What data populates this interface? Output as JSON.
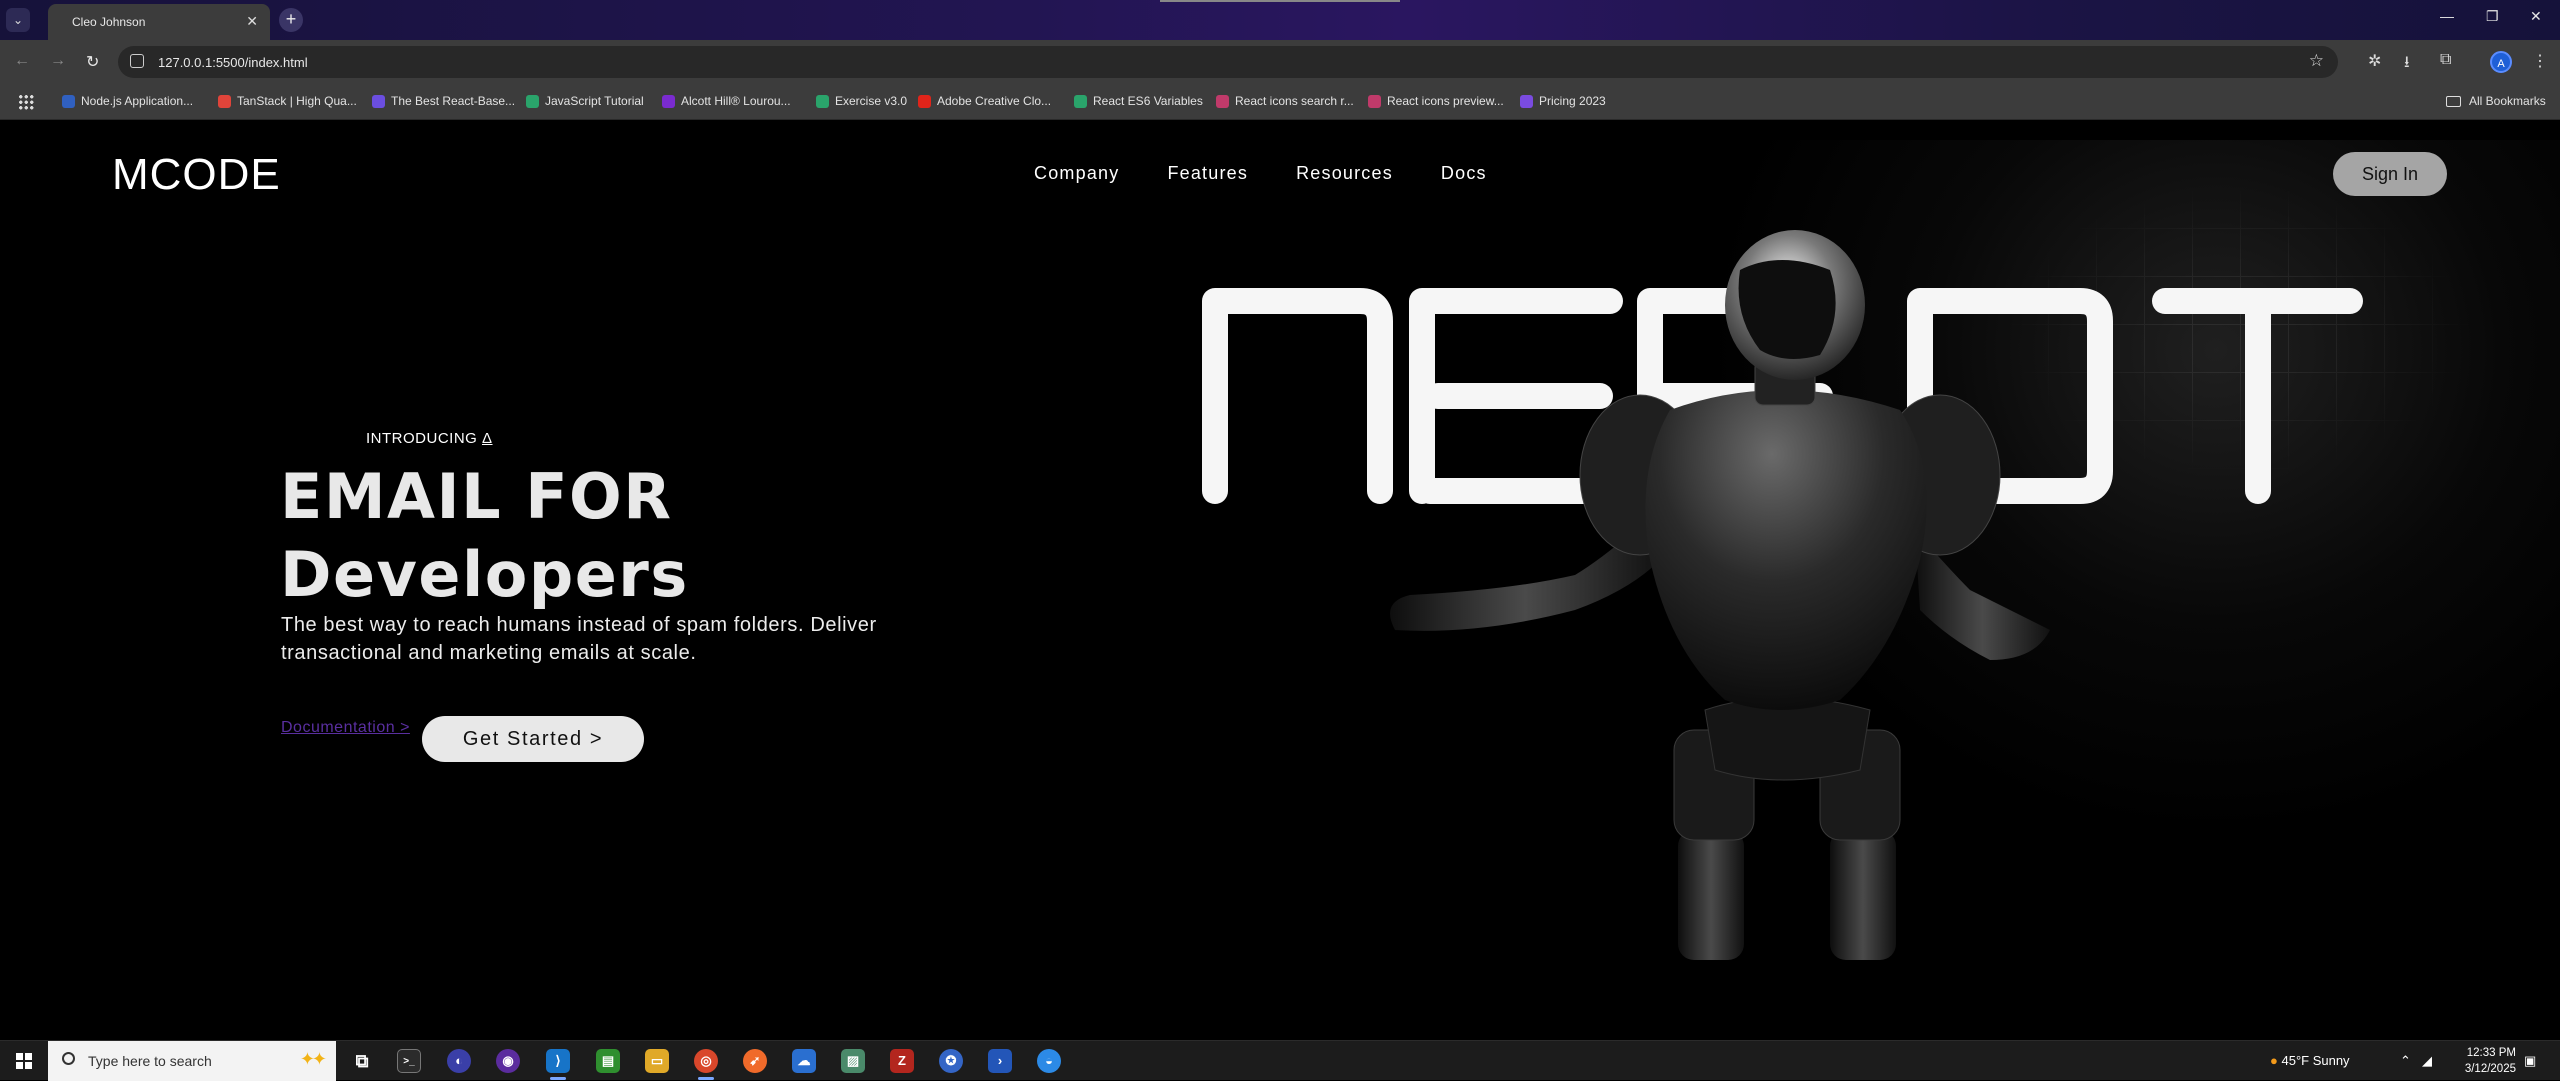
{
  "browser": {
    "tab_title": "Cleo Johnson",
    "url": "127.0.0.1:5500/index.html",
    "profile_initial": "A",
    "bookmarks": [
      {
        "label": "Node.js Application...",
        "color": "#3060c0"
      },
      {
        "label": "TanStack | High Qua...",
        "color": "#e0443a"
      },
      {
        "label": "The Best React-Base...",
        "color": "#6b4ee0"
      },
      {
        "label": "JavaScript Tutorial",
        "color": "#2aa46b"
      },
      {
        "label": "Alcott Hill® Lourou...",
        "color": "#7a2bd0"
      },
      {
        "label": "Exercise v3.0",
        "color": "#2aa46b"
      },
      {
        "label": "Adobe Creative Clo...",
        "color": "#e0241a"
      },
      {
        "label": "React ES6 Variables",
        "color": "#2aa46b"
      },
      {
        "label": "React icons search r...",
        "color": "#c03a6a"
      },
      {
        "label": "React icons preview...",
        "color": "#c03a6a"
      },
      {
        "label": "Pricing 2023",
        "color": "#7a4be0"
      }
    ],
    "all_bookmarks": "All Bookmarks"
  },
  "site": {
    "logo": "MCODE",
    "nav": [
      "Company",
      "Features",
      "Resources",
      "Docs"
    ],
    "signin_label": "Sign In",
    "intro": "INTRODUCING",
    "intro_mark": "Δ",
    "headline_line1": "EMAIL FOR",
    "headline_line2": "Developers",
    "subtitle": "The best way to reach humans instead of spam folders. Deliver transactional and marketing emails at scale.",
    "doc_link": "Documentation >",
    "cta_label": "Get Started >"
  },
  "taskbar": {
    "search_placeholder": "Type here to search",
    "weather": "45°F  Sunny",
    "time": "12:33 PM",
    "date": "3/12/2025"
  }
}
